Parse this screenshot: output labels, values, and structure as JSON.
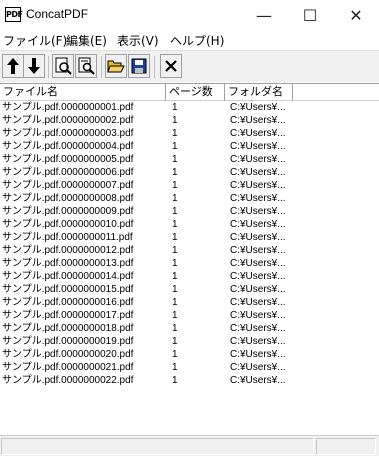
{
  "window": {
    "title": "ConcatPDF",
    "icon": "pdf-app-icon",
    "icon_text": "PDF",
    "minimize_glyph": "—",
    "maximize_glyph": "☐",
    "close_glyph": "✕"
  },
  "menu": [
    {
      "label": "ファイル(F)"
    },
    {
      "label": "編集(E)"
    },
    {
      "label": "表示(V)"
    },
    {
      "label": "ヘルプ(H)"
    }
  ],
  "toolbar": {
    "buttons": [
      {
        "name": "move-up-icon"
      },
      {
        "name": "move-down-icon"
      },
      {
        "name": "search-icon"
      },
      {
        "name": "preview-icon"
      },
      {
        "name": "open-folder-icon"
      },
      {
        "name": "save-icon"
      },
      {
        "name": "delete-icon"
      }
    ]
  },
  "table": {
    "columns": [
      "ファイル名",
      "ページ数",
      "フォルダ名"
    ],
    "rows": [
      {
        "name": "サンプル.pdf.0000000001.pdf",
        "pages": "1",
        "folder": "C:¥Users¥..."
      },
      {
        "name": "サンプル.pdf.0000000002.pdf",
        "pages": "1",
        "folder": "C:¥Users¥..."
      },
      {
        "name": "サンプル.pdf.0000000003.pdf",
        "pages": "1",
        "folder": "C:¥Users¥..."
      },
      {
        "name": "サンプル.pdf.0000000004.pdf",
        "pages": "1",
        "folder": "C:¥Users¥..."
      },
      {
        "name": "サンプル.pdf.0000000005.pdf",
        "pages": "1",
        "folder": "C:¥Users¥..."
      },
      {
        "name": "サンプル.pdf.0000000006.pdf",
        "pages": "1",
        "folder": "C:¥Users¥..."
      },
      {
        "name": "サンプル.pdf.0000000007.pdf",
        "pages": "1",
        "folder": "C:¥Users¥..."
      },
      {
        "name": "サンプル.pdf.0000000008.pdf",
        "pages": "1",
        "folder": "C:¥Users¥..."
      },
      {
        "name": "サンプル.pdf.0000000009.pdf",
        "pages": "1",
        "folder": "C:¥Users¥..."
      },
      {
        "name": "サンプル.pdf.0000000010.pdf",
        "pages": "1",
        "folder": "C:¥Users¥..."
      },
      {
        "name": "サンプル.pdf.0000000011.pdf",
        "pages": "1",
        "folder": "C:¥Users¥..."
      },
      {
        "name": "サンプル.pdf.0000000012.pdf",
        "pages": "1",
        "folder": "C:¥Users¥..."
      },
      {
        "name": "サンプル.pdf.0000000013.pdf",
        "pages": "1",
        "folder": "C:¥Users¥..."
      },
      {
        "name": "サンプル.pdf.0000000014.pdf",
        "pages": "1",
        "folder": "C:¥Users¥..."
      },
      {
        "name": "サンプル.pdf.0000000015.pdf",
        "pages": "1",
        "folder": "C:¥Users¥..."
      },
      {
        "name": "サンプル.pdf.0000000016.pdf",
        "pages": "1",
        "folder": "C:¥Users¥..."
      },
      {
        "name": "サンプル.pdf.0000000017.pdf",
        "pages": "1",
        "folder": "C:¥Users¥..."
      },
      {
        "name": "サンプル.pdf.0000000018.pdf",
        "pages": "1",
        "folder": "C:¥Users¥..."
      },
      {
        "name": "サンプル.pdf.0000000019.pdf",
        "pages": "1",
        "folder": "C:¥Users¥..."
      },
      {
        "name": "サンプル.pdf.0000000020.pdf",
        "pages": "1",
        "folder": "C:¥Users¥..."
      },
      {
        "name": "サンプル.pdf.0000000021.pdf",
        "pages": "1",
        "folder": "C:¥Users¥..."
      },
      {
        "name": "サンプル.pdf.0000000022.pdf",
        "pages": "1",
        "folder": "C:¥Users¥..."
      }
    ]
  },
  "colors": {
    "toolbar_bg": "#f0f0f0",
    "window_bg": "#ffffff",
    "folder_yellow": "#e8b830",
    "save_blue": "#1f3f9f"
  }
}
